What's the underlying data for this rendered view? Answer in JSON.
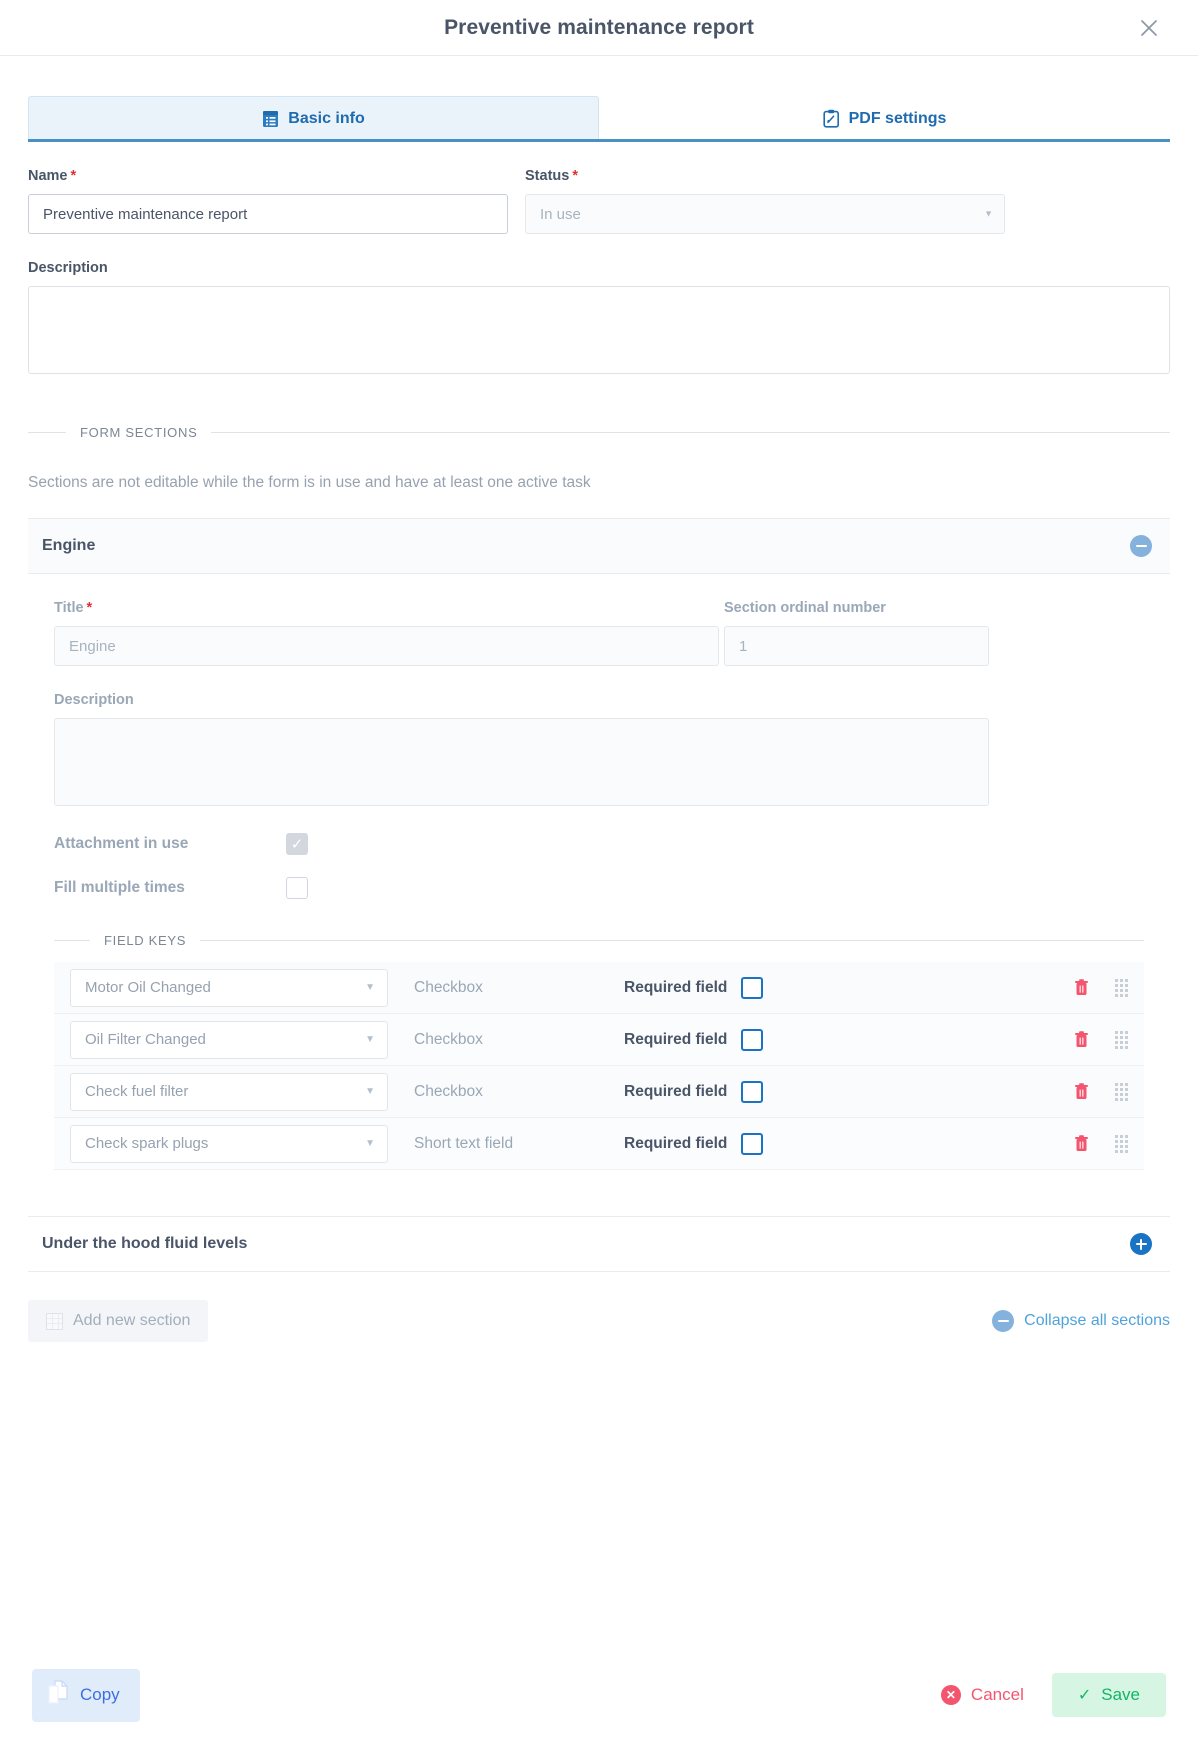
{
  "dialog": {
    "title": "Preventive maintenance report",
    "close_icon": "close-icon"
  },
  "tabs": [
    {
      "label": "Basic info",
      "icon": "list-document-icon",
      "active": true
    },
    {
      "label": "PDF settings",
      "icon": "clipboard-edit-icon",
      "active": false
    }
  ],
  "basic_info": {
    "name_label": "Name",
    "name_required": "*",
    "name_value": "Preventive maintenance report",
    "status_label": "Status",
    "status_required": "*",
    "status_value": "In use",
    "description_label": "Description",
    "description_value": "",
    "description_placeholder": ""
  },
  "form_sections": {
    "legend": "FORM SECTIONS",
    "hint": "Sections are not editable while the form is in use and have at least one active task",
    "sections": [
      {
        "name": "Engine",
        "expanded": true,
        "toggle_icon": "minus-circle-icon",
        "title_label": "Title",
        "title_required": "*",
        "title_value": "Engine",
        "ordinal_label": "Section ordinal number",
        "ordinal_value": "1",
        "description_label": "Description",
        "description_value": "",
        "attachment_label": "Attachment in use",
        "attachment_checked": true,
        "fill_multiple_label": "Fill multiple times",
        "fill_multiple_checked": false,
        "field_keys_legend": "FIELD KEYS",
        "required_field_label": "Required field",
        "rows": [
          {
            "key": "Motor Oil Changed",
            "type": "Checkbox",
            "required": false
          },
          {
            "key": "Oil Filter Changed",
            "type": "Checkbox",
            "required": false
          },
          {
            "key": "Check fuel filter",
            "type": "Checkbox",
            "required": false
          },
          {
            "key": "Check spark plugs",
            "type": "Short text field",
            "required": false
          }
        ]
      },
      {
        "name": "Under the hood fluid levels",
        "expanded": false,
        "toggle_icon": "plus-circle-icon"
      }
    ],
    "add_section_label": "Add new section",
    "collapse_all_label": "Collapse all sections"
  },
  "footer": {
    "copy_label": "Copy",
    "cancel_label": "Cancel",
    "save_label": "Save"
  },
  "colors": {
    "accent_blue": "#1a73c4",
    "tab_active_bg": "#eaf3fa",
    "danger": "#f4556e",
    "success": "#13b465",
    "required_star": "#e03131"
  }
}
